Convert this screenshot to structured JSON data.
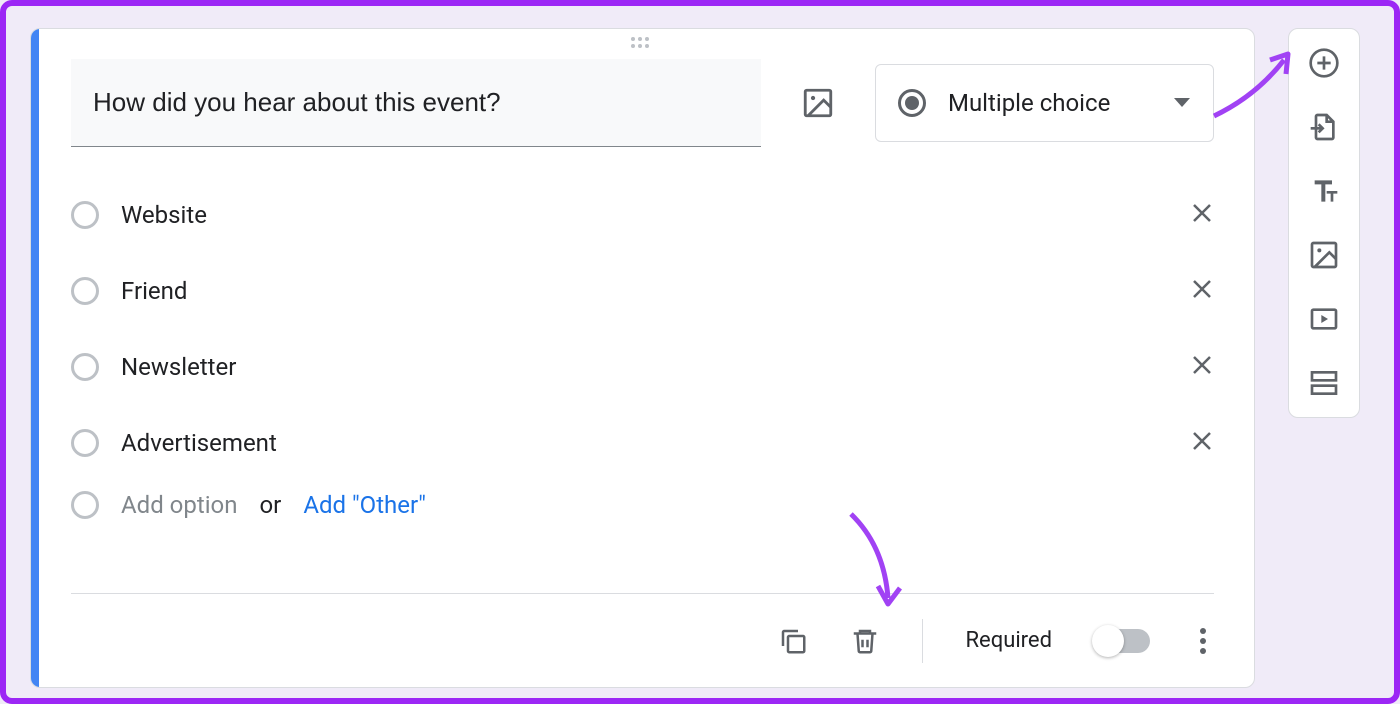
{
  "question": {
    "text": "How did you hear about this event?",
    "type_label": "Multiple choice"
  },
  "options": [
    {
      "label": "Website"
    },
    {
      "label": "Friend"
    },
    {
      "label": "Newsletter"
    },
    {
      "label": "Advertisement"
    }
  ],
  "add_row": {
    "add_option": "Add option",
    "or": "or",
    "add_other": "Add \"Other\""
  },
  "footer": {
    "required_label": "Required"
  },
  "sidebar_tools": [
    "add-question",
    "import-questions",
    "add-title",
    "add-image",
    "add-video",
    "add-section"
  ]
}
